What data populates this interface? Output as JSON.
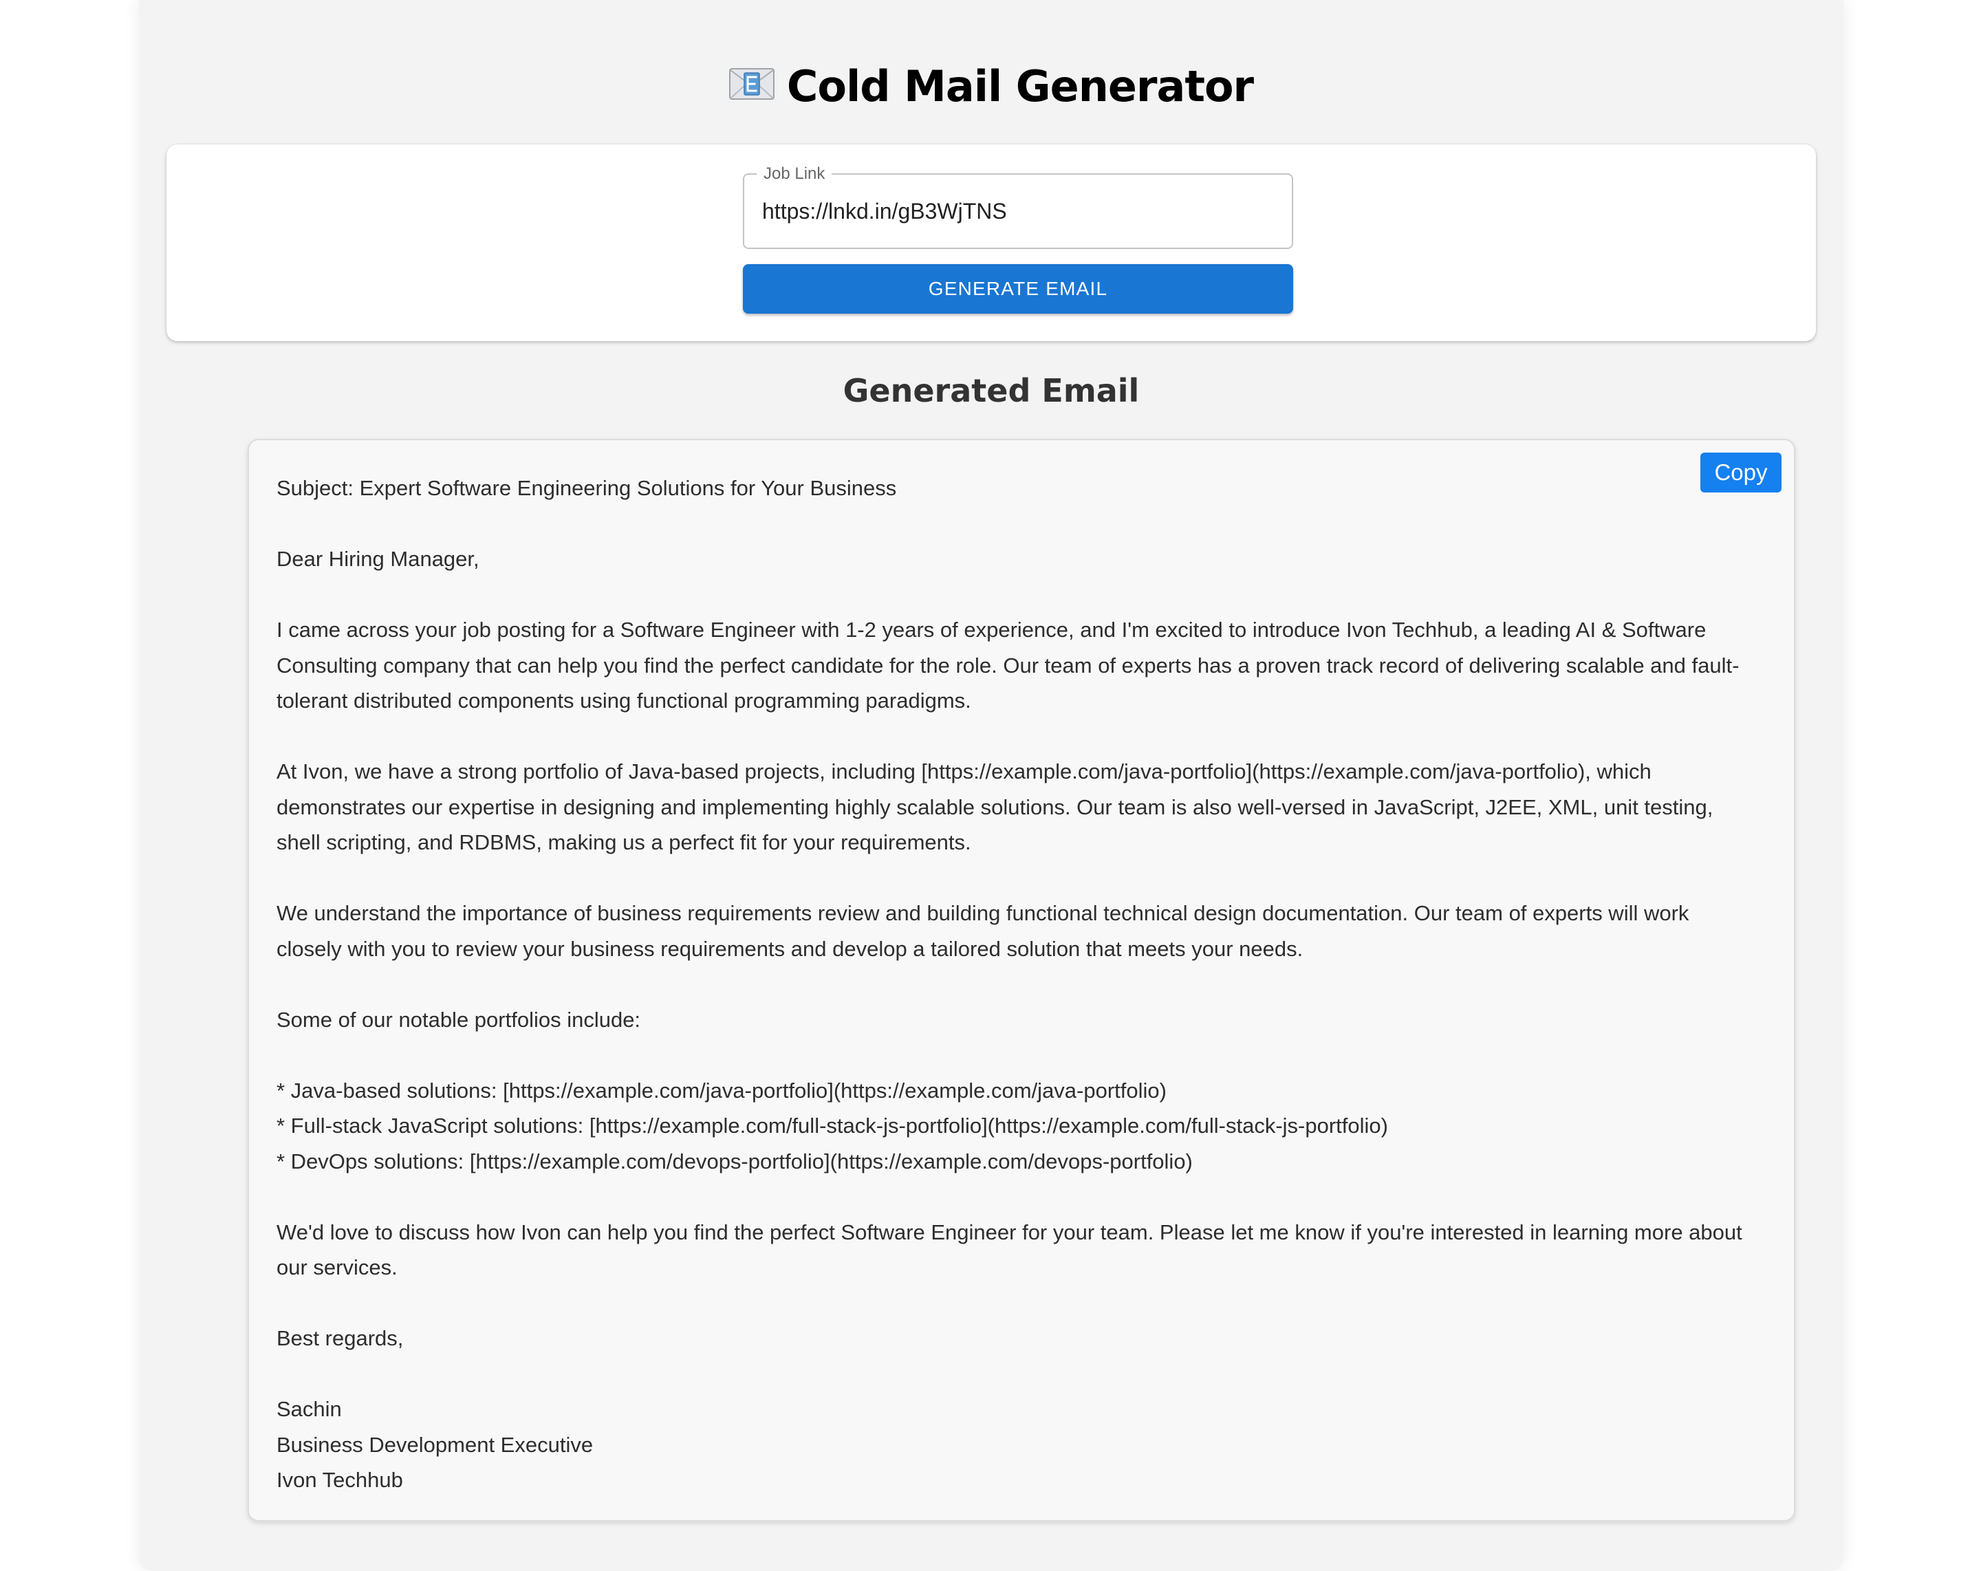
{
  "header": {
    "title": "Cold Mail Generator",
    "icon": "envelope-icon"
  },
  "form": {
    "job_link_label": "Job Link",
    "job_link_value": "https://lnkd.in/gB3WjTNS",
    "generate_button_label": "GENERATE EMAIL"
  },
  "result": {
    "section_title": "Generated Email",
    "copy_button_label": "Copy",
    "subject": "Subject: Expert Software Engineering Solutions for Your Business",
    "greeting": "Dear Hiring Manager,",
    "paragraph_1": "I came across your job posting for a Software Engineer with 1-2 years of experience, and I'm excited to introduce Ivon Techhub, a leading AI & Software Consulting company that can help you find the perfect candidate for the role. Our team of experts has a proven track record of delivering scalable and fault-tolerant distributed components using functional programming paradigms.",
    "paragraph_2": "At Ivon, we have a strong portfolio of Java-based projects, including [https://example.com/java-portfolio](https://example.com/java-portfolio), which demonstrates our expertise in designing and implementing highly scalable solutions. Our team is also well-versed in JavaScript, J2EE, XML, unit testing, shell scripting, and RDBMS, making us a perfect fit for your requirements.",
    "paragraph_3": "We understand the importance of business requirements review and building functional technical design documentation. Our team of experts will work closely with you to review your business requirements and develop a tailored solution that meets your needs.",
    "portfolio_intro": "Some of our notable portfolios include:",
    "portfolio_items": [
      "* Java-based solutions: [https://example.com/java-portfolio](https://example.com/java-portfolio)",
      "* Full-stack JavaScript solutions: [https://example.com/full-stack-js-portfolio](https://example.com/full-stack-js-portfolio)",
      "* DevOps solutions: [https://example.com/devops-portfolio](https://example.com/devops-portfolio)"
    ],
    "closing_paragraph": "We'd love to discuss how Ivon can help you find the perfect Software Engineer for your team. Please let me know if you're interested in learning more about our services.",
    "sign_off": "Best regards,",
    "signature": {
      "name": "Sachin",
      "position": "Business Development Executive",
      "company": "Ivon Techhub"
    }
  },
  "colors": {
    "primary_button": "#1976d2",
    "copy_button": "#1580f0",
    "page_background": "#f3f3f3"
  }
}
